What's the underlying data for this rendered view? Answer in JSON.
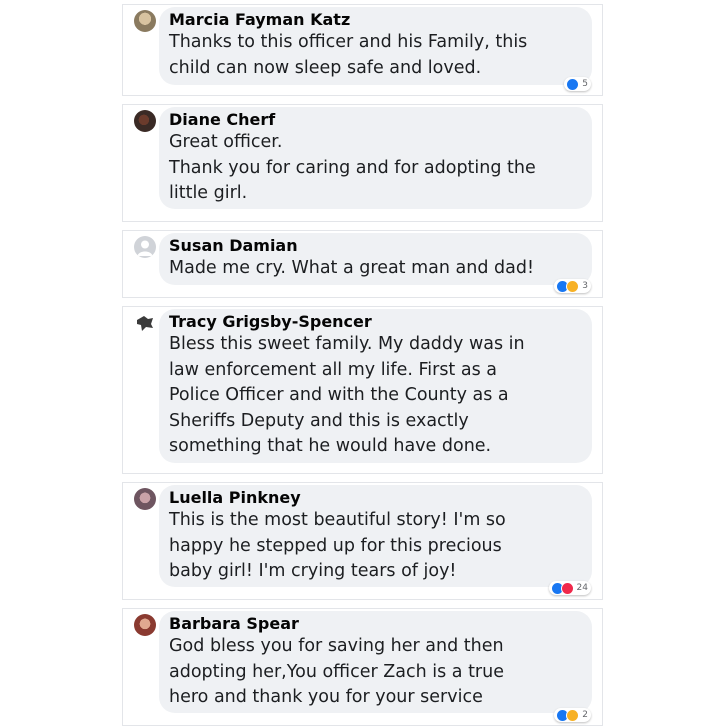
{
  "comments": [
    {
      "name": "Marcia Fayman Katz",
      "lines": [
        "Thanks to this officer and his Family, this",
        "child can now sleep safe and loved."
      ],
      "reaction_count": "5",
      "reactions": [
        "like-icon"
      ]
    },
    {
      "name": "Diane Cherf",
      "lines": [
        "Great officer.",
        "Thank you for caring and for adopting the",
        "little girl."
      ]
    },
    {
      "name": "Susan Damian",
      "lines": [
        "Made me cry. What a great man and dad!"
      ],
      "reaction_count": "3",
      "reactions": [
        "like-icon",
        "care-icon"
      ]
    },
    {
      "name": "Tracy Grigsby-Spencer",
      "lines": [
        "Bless this sweet family. My daddy was in",
        "law enforcement all my life. First as a",
        "Police Officer and with the County as a",
        "Sheriffs Deputy and this is exactly",
        "something that he would have done."
      ]
    },
    {
      "name": "Luella Pinkney",
      "lines": [
        "This is the most beautiful story! I'm so",
        "happy he stepped up for this precious",
        "baby girl! I'm crying tears of joy!"
      ],
      "reaction_count": "24",
      "reactions": [
        "like-icon",
        "love-icon"
      ]
    },
    {
      "name": "Barbara Spear",
      "lines": [
        "God bless you for saving her and then",
        "adopting her,You officer Zach is a true",
        "hero and thank you for your service"
      ],
      "reaction_count": "2",
      "reactions": [
        "like-icon",
        "care-icon"
      ]
    }
  ],
  "colors": {
    "like": "#1877f2",
    "love": "#f0284a",
    "care": "#f7b125",
    "bubble": "#eff1f4"
  }
}
